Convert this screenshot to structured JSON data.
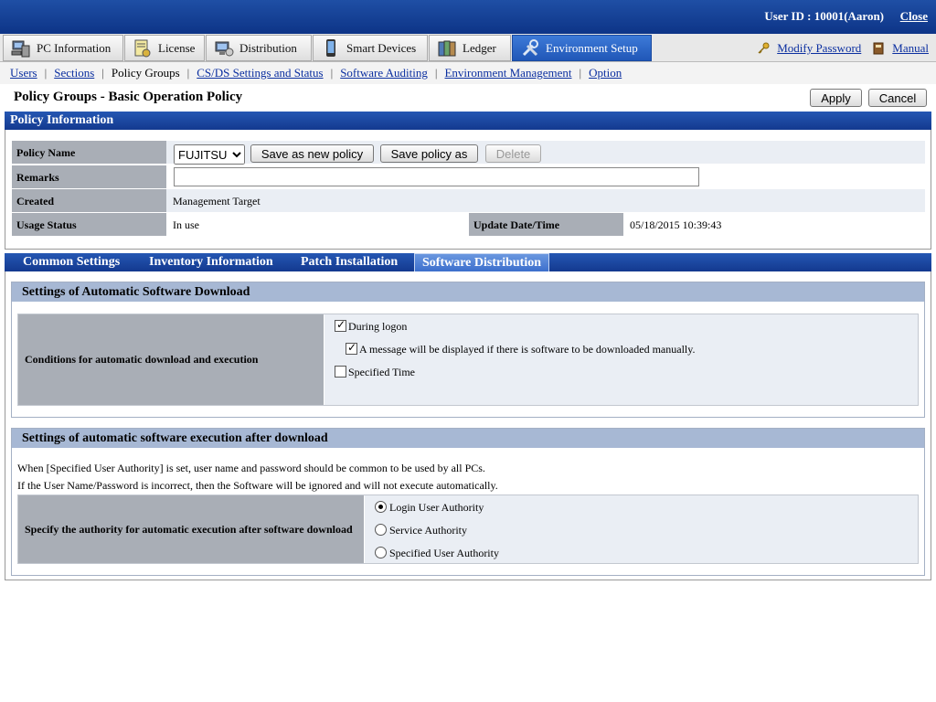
{
  "header": {
    "user_label": "User ID : ",
    "user_value": "10001(Aaron)",
    "close": "Close"
  },
  "tabs": [
    {
      "label": "PC Information",
      "icon": "pc-icon"
    },
    {
      "label": "License",
      "icon": "license-icon"
    },
    {
      "label": "Distribution",
      "icon": "distribution-icon"
    },
    {
      "label": "Smart Devices",
      "icon": "smart-device-icon"
    },
    {
      "label": "Ledger",
      "icon": "ledger-icon"
    },
    {
      "label": "Environment Setup",
      "icon": "tools-icon",
      "active": true
    }
  ],
  "right_links": {
    "modify_password": "Modify Password",
    "manual": "Manual"
  },
  "subnav": [
    "Users",
    "Sections",
    "Policy Groups",
    "CS/DS Settings and Status",
    "Software Auditing",
    "Environment Management",
    "Option"
  ],
  "page": {
    "title": "Policy Groups - Basic Operation Policy",
    "apply": "Apply",
    "cancel": "Cancel"
  },
  "policy": {
    "heading": "Policy Information",
    "name_label": "Policy Name",
    "name_value": "FUJITSU",
    "save_new": "Save as new policy",
    "save_as": "Save policy as",
    "delete": "Delete",
    "remarks_label": "Remarks",
    "remarks_value": "",
    "created_label": "Created",
    "created_value": "Management Target",
    "usage_label": "Usage Status",
    "usage_value": "In use",
    "update_label": "Update Date/Time",
    "update_value": "05/18/2015 10:39:43"
  },
  "subtabs": [
    "Common Settings",
    "Inventory Information",
    "Patch Installation",
    "Software Distribution"
  ],
  "download": {
    "heading": "Settings of Automatic Software Download",
    "label": "Conditions for automatic download and execution",
    "opt_logon": "During logon",
    "opt_message": "A message will be displayed if there is software to be downloaded manually.",
    "opt_time": "Specified Time"
  },
  "execution": {
    "heading": "Settings of automatic software execution after download",
    "note1": "When [Specified User Authority] is set, user name and password should be common to be used by all PCs.",
    "note2": "If the User Name/Password is incorrect, then the Software will be ignored and will not execute automatically.",
    "label": "Specify the authority for automatic execution after software download",
    "opt_login": "Login User Authority",
    "opt_service": "Service Authority",
    "opt_specified": "Specified User Authority"
  }
}
